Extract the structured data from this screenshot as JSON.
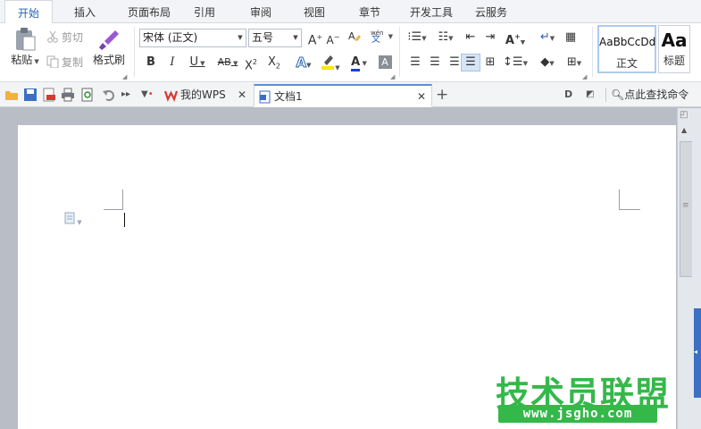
{
  "menu": {
    "tabs": [
      "开始",
      "插入",
      "页面布局",
      "引用",
      "审阅",
      "视图",
      "章节",
      "开发工具",
      "云服务"
    ],
    "active": "开始"
  },
  "ribbon": {
    "clipboard": {
      "paste_label": "粘贴",
      "cut_label": "剪切",
      "copy_label": "复制",
      "format_painter_label": "格式刷"
    },
    "font": {
      "font_name": "宋体 (正文)",
      "font_size": "五号",
      "phonetic_glyph": "wén"
    },
    "styles": {
      "normal_sample": "AaBbCcDd",
      "normal_label": "正文",
      "heading_sample": "Aa",
      "heading_label": "标题"
    },
    "colors": {
      "highlight": "#ffe600",
      "font_color": "#1a3fd8",
      "accent": "#2a62b8"
    }
  },
  "quickbar": {
    "doc_tabs": [
      {
        "label": "我的WPS"
      },
      {
        "label": "文档1"
      }
    ],
    "search_label": "点此查找命令"
  },
  "watermark": {
    "text": "技术员联盟",
    "url": "www.jsgho.com"
  }
}
